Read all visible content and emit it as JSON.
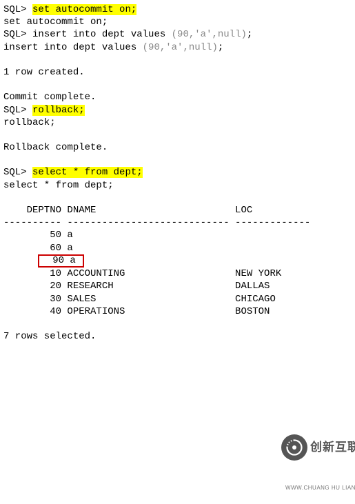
{
  "lines": {
    "0": {
      "prompt": "SQL>",
      "cmd": "set autocommit on;"
    },
    "1": "set autocommit on;",
    "2": {
      "prompt": "SQL>",
      "cmd": "insert into dept values",
      "vals": "(90,'a',null)",
      "tail": ";"
    },
    "3": {
      "cmd": "insert into dept values",
      "vals": "(90,'a',null)",
      "tail": ";"
    },
    "4": "1 row created.",
    "5": "Commit complete.",
    "6": {
      "prompt": "SQL>",
      "cmd": "rollback;"
    },
    "7": "rollback;",
    "8": "Rollback complete.",
    "9": {
      "prompt": "SQL>",
      "cmd": "select * from dept;"
    },
    "10": "select * from dept;",
    "11": "7 rows selected."
  },
  "table": {
    "header": "    DEPTNO DNAME                        LOC",
    "divider": "---------- ---------------------------- -------------",
    "rows": {
      "0": "        50 a",
      "1": "        60 a",
      "2": {
        "pre": "      ",
        "box": "  90 a "
      },
      "3": "        10 ACCOUNTING                   NEW YORK",
      "4": "        20 RESEARCH                     DALLAS",
      "5": "        30 SALES                        CHICAGO",
      "6": "        40 OPERATIONS                   BOSTON"
    }
  },
  "watermark": {
    "brand": "创新互联",
    "sub": "WWW.CHUANG HU LIAN"
  }
}
